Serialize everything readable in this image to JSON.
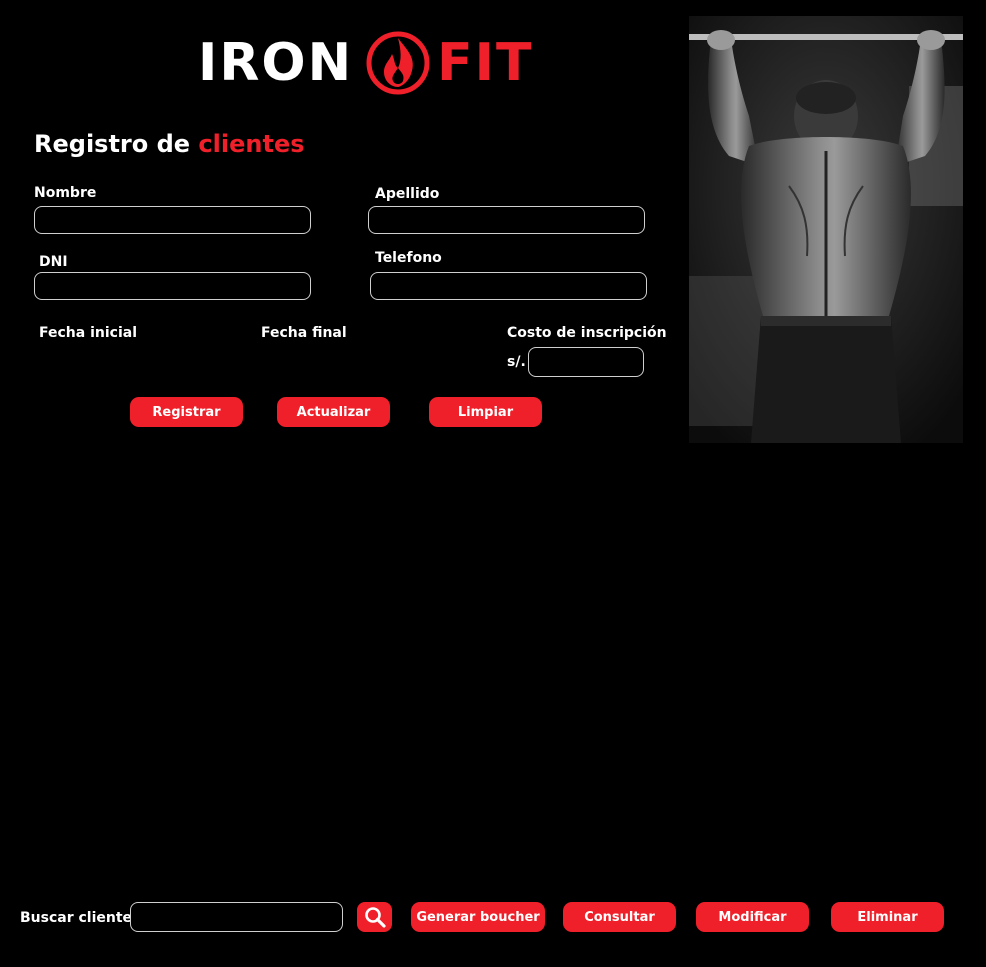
{
  "brand": {
    "word1": "IRON",
    "word2": "FIT",
    "accent_color": "#f0202a"
  },
  "form": {
    "title_prefix": "Registro de",
    "title_accent": "clientes",
    "labels": {
      "nombre": "Nombre",
      "apellido": "Apellido",
      "dni": "DNI",
      "telefono": "Telefono",
      "fecha_inicial": "Fecha inicial",
      "fecha_final": "Fecha final",
      "costo": "Costo de inscripción",
      "currency": "s/."
    },
    "values": {
      "nombre": "",
      "apellido": "",
      "dni": "",
      "telefono": "",
      "costo": ""
    },
    "buttons": {
      "registrar": "Registrar",
      "actualizar": "Actualizar",
      "limpiar": "Limpiar"
    }
  },
  "hero_image": {
    "description_icon": "athlete-photo"
  },
  "bottom_bar": {
    "search_label": "Buscar cliente",
    "search_value": "",
    "search_icon": "magnifier-icon",
    "buttons": {
      "generar": "Generar boucher",
      "consultar": "Consultar",
      "modificar": "Modificar",
      "eliminar": "Eliminar"
    }
  }
}
